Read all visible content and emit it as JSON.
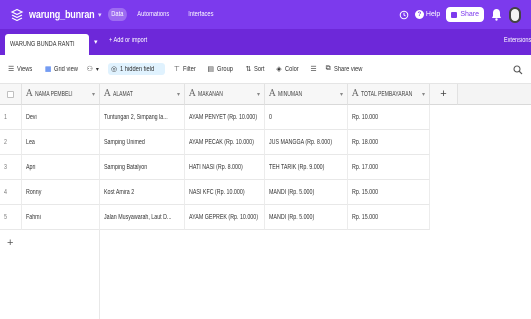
{
  "colors": {
    "header_bg": "#7c3aed",
    "tabbar_bg": "#6d28d9",
    "accent": "#7c3aed"
  },
  "header": {
    "base_name": "warung_bunran",
    "nav": [
      {
        "label": "Data",
        "active": true
      },
      {
        "label": "Automations",
        "active": false
      },
      {
        "label": "Interfaces",
        "active": false
      }
    ],
    "help_label": "Help",
    "share_label": "Share",
    "icons": [
      "base-logo-icon",
      "history-icon",
      "help-icon",
      "share-icon",
      "bell-icon",
      "avatar"
    ]
  },
  "tabs": {
    "active_table": "WARUNG BUNDA RANTI",
    "add_import": "+ Add or import",
    "extensions": "Extensions"
  },
  "toolbar": {
    "views": "Views",
    "grid_view": "Grid view",
    "hidden_field": "1 hidden field",
    "filter": "Filter",
    "group": "Group",
    "sort": "Sort",
    "color": "Color",
    "share_view": "Share view"
  },
  "table": {
    "columns": [
      {
        "type_icon": "A",
        "label": "NAMA PEMBELI"
      },
      {
        "type_icon": "A",
        "label": "ALAMAT"
      },
      {
        "type_icon": "A",
        "label": "MAKANAN"
      },
      {
        "type_icon": "A",
        "label": "MINUMAN"
      },
      {
        "type_icon": "A",
        "label": "TOTAL PEMBAYARAN"
      }
    ],
    "rows": [
      {
        "num": "1",
        "cells": [
          "Devi",
          "Tuntungan 2, Simpang la...",
          "AYAM PENYET (Rp. 10.000)",
          "0",
          "Rp. 10.000"
        ]
      },
      {
        "num": "2",
        "cells": [
          "Lea",
          "Samping Unimed",
          "AYAM PECAK (Rp. 10.000)",
          "JUS MANGGA (Rp. 8.000)",
          "Rp. 18.000"
        ]
      },
      {
        "num": "3",
        "cells": [
          "Apri",
          "Samping Batalyon",
          "HATI NASI (Rp. 8.000)",
          "TEH TARIK (Rp. 9.000)",
          "Rp. 17.000"
        ]
      },
      {
        "num": "4",
        "cells": [
          "Ronny",
          "Kost Amira 2",
          "NASI KFC (Rp. 10.000)",
          "MANDI (Rp. 5.000)",
          "Rp. 15.000"
        ]
      },
      {
        "num": "5",
        "cells": [
          "Fahmi",
          "Jalan Musyawarah, Laut D...",
          "AYAM GEPREK (Rp. 10.000)",
          "MANDI (Rp. 5.000)",
          "Rp. 15.000"
        ]
      }
    ],
    "add_row": "+",
    "add_column": "+"
  }
}
